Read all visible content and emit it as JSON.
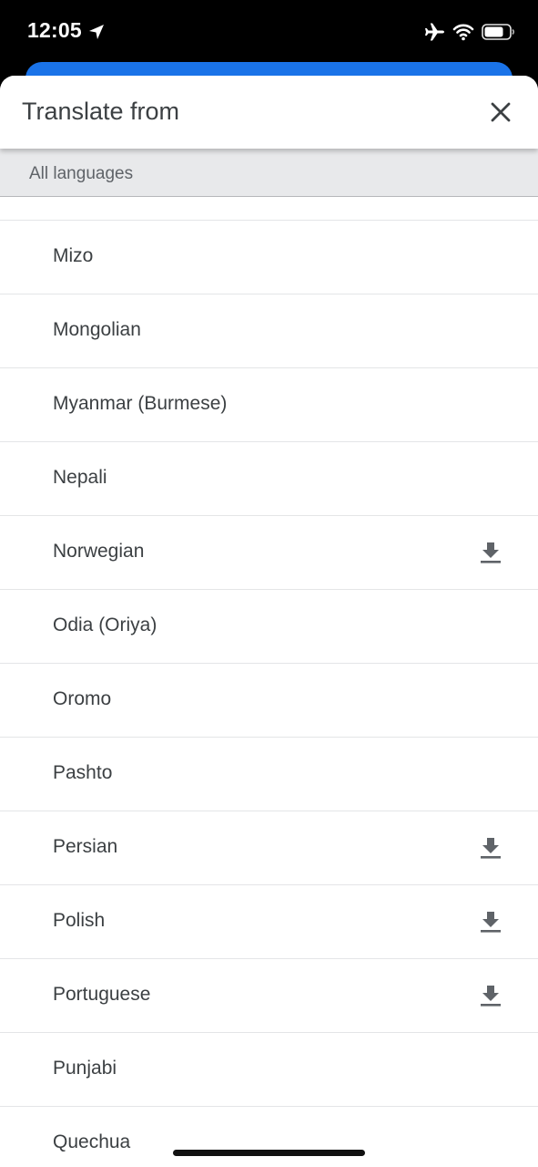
{
  "status_bar": {
    "time": "12:05",
    "icons": [
      "location-arrow-icon",
      "airplane-icon",
      "wifi-icon",
      "battery-icon"
    ]
  },
  "sheet": {
    "title": "Translate from",
    "close_icon": "close-icon",
    "section_label": "All languages"
  },
  "languages": [
    {
      "label": "Mizo",
      "downloadable": false
    },
    {
      "label": "Mongolian",
      "downloadable": false
    },
    {
      "label": "Myanmar (Burmese)",
      "downloadable": false
    },
    {
      "label": "Nepali",
      "downloadable": false
    },
    {
      "label": "Norwegian",
      "downloadable": true
    },
    {
      "label": "Odia (Oriya)",
      "downloadable": false
    },
    {
      "label": "Oromo",
      "downloadable": false
    },
    {
      "label": "Pashto",
      "downloadable": false
    },
    {
      "label": "Persian",
      "downloadable": true
    },
    {
      "label": "Polish",
      "downloadable": true
    },
    {
      "label": "Portuguese",
      "downloadable": true
    },
    {
      "label": "Punjabi",
      "downloadable": false
    },
    {
      "label": "Quechua",
      "downloadable": false
    }
  ],
  "colors": {
    "accent": "#1a73e8",
    "text": "#3c4043",
    "section_bg": "#e8e9eb",
    "icon": "#5f6368"
  }
}
